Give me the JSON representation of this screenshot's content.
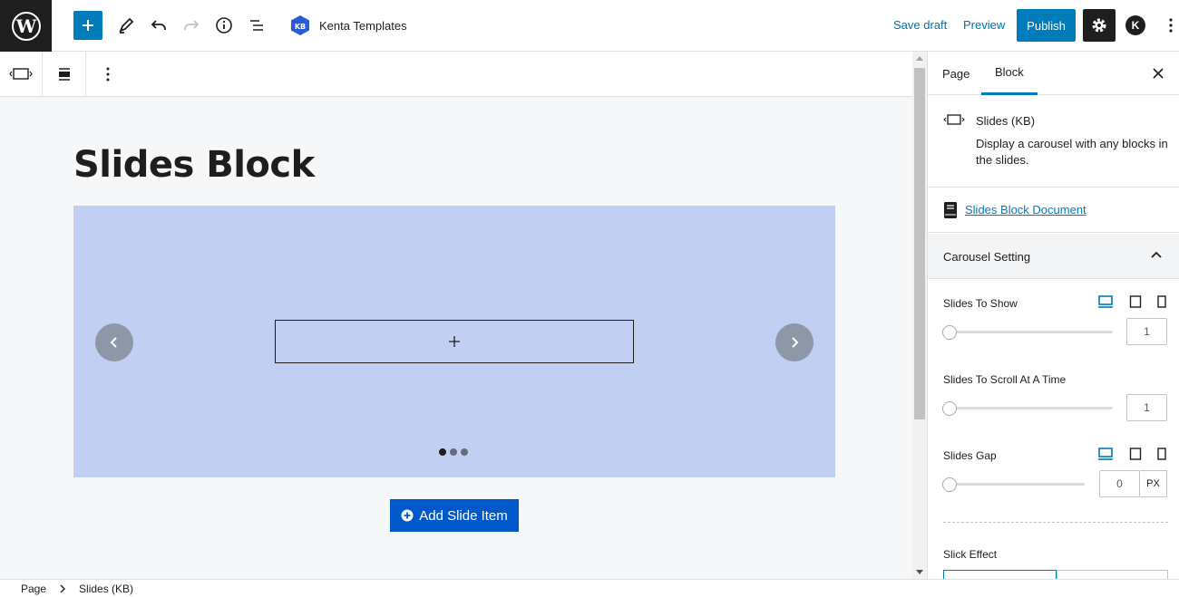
{
  "header": {
    "site_name": "Kenta Templates",
    "save_draft": "Save draft",
    "preview": "Preview",
    "publish": "Publish",
    "avatar_initial": "K"
  },
  "editor": {
    "page_title": "Slides Block",
    "add_slide_label": "Add Slide Item",
    "slide_dots": 3,
    "active_dot": 0
  },
  "sidebar": {
    "tabs": [
      {
        "label": "Page",
        "active": false
      },
      {
        "label": "Block",
        "active": true
      }
    ],
    "block_card": {
      "title": "Slides (KB)",
      "description": "Display a carousel with any blocks in the slides."
    },
    "doc_link": "Slides Block Document",
    "panel": {
      "title": "Carousel Setting",
      "slides_to_show": {
        "label": "Slides To Show",
        "value": "1"
      },
      "slides_to_scroll": {
        "label": "Slides To Scroll At A Time",
        "value": "1"
      },
      "slides_gap": {
        "label": "Slides Gap",
        "value": "0",
        "unit": "PX"
      },
      "slick_effect": {
        "label": "Slick Effect"
      }
    }
  },
  "footer": {
    "breadcrumb": [
      "Page",
      "Slides (KB)"
    ]
  },
  "colors": {
    "accent": "#007cba",
    "slider_bg": "#c1cff2",
    "add_slide_bg": "#0059c9"
  }
}
